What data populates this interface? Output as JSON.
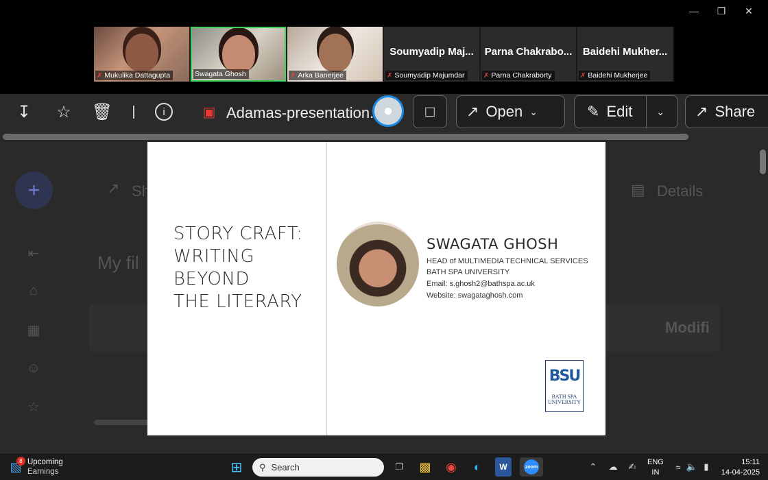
{
  "participants": [
    {
      "name": "Mukulika Dattagupta",
      "video": true,
      "muted": true
    },
    {
      "name": "Swagata Ghosh",
      "video": true,
      "muted": false,
      "active_speaker": true
    },
    {
      "name": "Arka Banerjee",
      "video": true,
      "muted": true
    },
    {
      "name": "Soumyadip Majumdar",
      "display": "Soumyadip Maj...",
      "video": false,
      "muted": true
    },
    {
      "name": "Parna Chakraborty",
      "display": "Parna Chakrabo...",
      "video": false,
      "muted": true
    },
    {
      "name": "Baidehi Mukherjee",
      "display": "Baidehi Mukher...",
      "video": false,
      "muted": true
    }
  ],
  "viewer": {
    "file_name": "Adamas-presentation.",
    "open_label": "Open",
    "edit_label": "Edit",
    "share_label": "Share",
    "bg_share": "Sh",
    "bg_details": "Details",
    "bg_my_files": "My fil",
    "bg_modified": "Modifi"
  },
  "slide": {
    "title_lines": [
      "STORY CRAFT:",
      "WRITING",
      "BEYOND",
      "THE LITERARY"
    ],
    "presenter_name": "SWAGATA GHOSH",
    "role": "HEAD of MULTIMEDIA TECHNICAL SERVICES",
    "org": "BATH SPA UNIVERSITY",
    "email": "Email: s.ghosh2@bathspa.ac.uk",
    "website": "Website: swagataghosh.com",
    "logo_mark": "BSU",
    "logo_text_1": "BATH SPA",
    "logo_text_2": "UNIVERSITY"
  },
  "taskbar": {
    "weather_title": "Upcoming",
    "weather_sub": "Earnings",
    "notif_count": "8",
    "search_placeholder": "Search",
    "lang_1": "ENG",
    "lang_2": "IN",
    "time": "15:11",
    "date": "14-04-2025"
  },
  "colors": {
    "accent": "#1e88e5",
    "active_speaker": "#3ed35a",
    "muted": "#e0443e"
  }
}
